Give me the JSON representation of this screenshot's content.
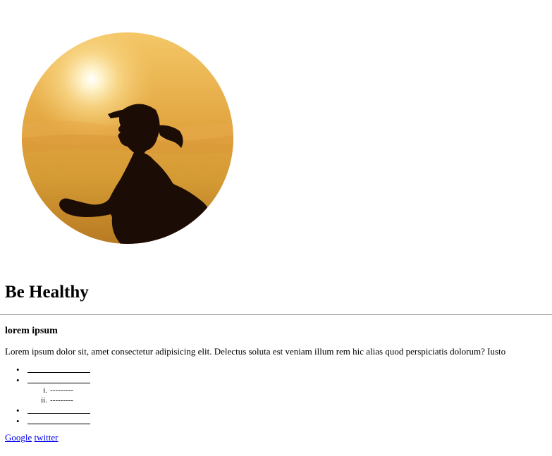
{
  "hero": {
    "image_description_icon": "runner-silhouette-icon",
    "sky_top": "#f2c25a",
    "sky_bottom": "#c98a1e",
    "sun_color": "#fff6d8",
    "silhouette_color": "#1c0c06"
  },
  "heading": "Be Healthy",
  "subheading": "lorem ipsum",
  "paragraph": "Lorem ipsum dolor sit, amet consectetur adipisicing elit. Delectus soluta est veniam illum rem hic alias quod perspiciatis dolorum? Iusto",
  "list": {
    "bullet": "•",
    "sub_items": [
      {
        "marker": "i.",
        "text": "---------"
      },
      {
        "marker": "ii.",
        "text": "---------"
      }
    ]
  },
  "links": {
    "google": "Google",
    "twitter": "twitter"
  }
}
